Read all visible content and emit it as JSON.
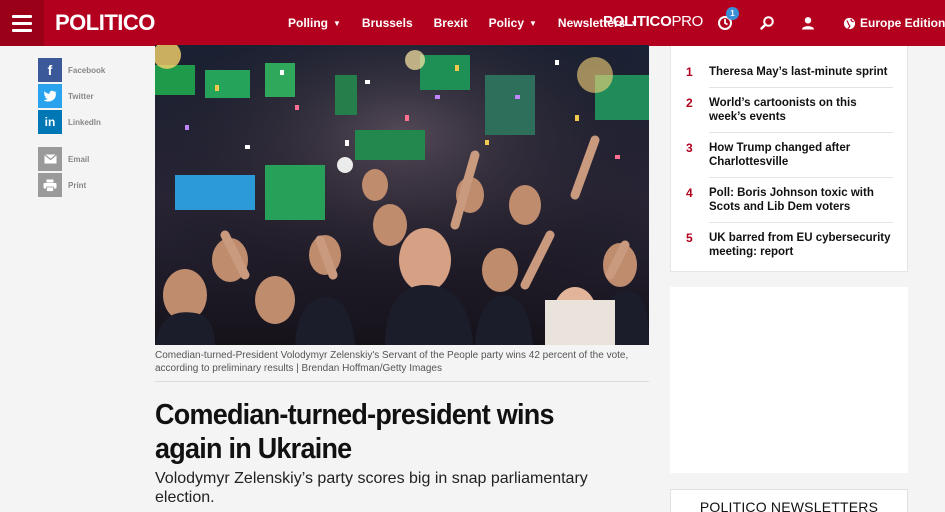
{
  "header": {
    "logo": "POLITICO",
    "nav": [
      {
        "label": "Polling",
        "dropdown": true
      },
      {
        "label": "Brussels",
        "dropdown": false
      },
      {
        "label": "Brexit",
        "dropdown": false
      },
      {
        "label": "Policy",
        "dropdown": true
      },
      {
        "label": "Newsletters",
        "dropdown": true
      }
    ],
    "pro_logo_main": "POLITICO",
    "pro_logo_suffix": "PRO",
    "notification_count": "1",
    "edition_label": "Europe Edition",
    "colors": {
      "brand": "#b3001e",
      "badge": "#3b8fd6"
    }
  },
  "share": {
    "items": [
      {
        "label": "Facebook",
        "icon": "facebook-icon"
      },
      {
        "label": "Twitter",
        "icon": "twitter-icon"
      },
      {
        "label": "LinkedIn",
        "icon": "linkedin-icon"
      },
      {
        "label": "Email",
        "icon": "email-icon"
      },
      {
        "label": "Print",
        "icon": "print-icon"
      }
    ]
  },
  "article": {
    "photo_caption": "Comedian-turned-President Volodymyr Zelenskiy's Servant of the People party wins 42 percent of the vote, according to preliminary results | Brendan Hoffman/Getty Images",
    "headline": "Comedian-turned-president wins again in Ukraine",
    "dek": "Volodymyr Zelenskiy’s party scores big in snap parliamentary election."
  },
  "most_read": [
    {
      "num": "1",
      "title": "Theresa May’s last-minute sprint"
    },
    {
      "num": "2",
      "title": "World’s cartoonists on this week’s events"
    },
    {
      "num": "3",
      "title": "How Trump changed after Charlottesville"
    },
    {
      "num": "4",
      "title": "Poll: Boris Johnson toxic with Scots and Lib Dem voters"
    },
    {
      "num": "5",
      "title": "UK barred from EU cybersecurity meeting: report"
    }
  ],
  "newsletters_title": "POLITICO NEWSLETTERS"
}
